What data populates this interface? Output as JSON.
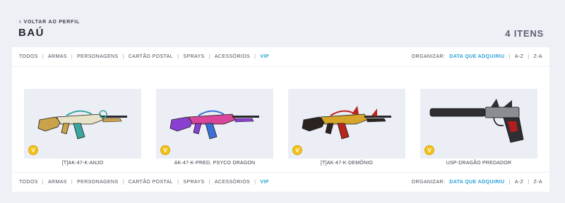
{
  "header": {
    "back_label": "VOLTAR AO PERFIL",
    "title": "BAÚ",
    "count": "4 ITENS"
  },
  "filters": {
    "categories": [
      "TODOS",
      "ARMAS",
      "PERSONAGENS",
      "CARTÃO POSTAL",
      "SPRAYS",
      "ACESSÓRIOS",
      "VIP"
    ],
    "active_category": "VIP",
    "sort_label": "ORGANIZAR:",
    "sort_options": [
      "DATA QUE ADQUIRIU",
      "A-Z",
      "Z-A"
    ],
    "active_sort": "DATA QUE ADQUIRIU"
  },
  "items": [
    {
      "name": "[T]AK-47-K-ANJO",
      "badge": "V",
      "palette": [
        "#c9a24a",
        "#e8e2c8",
        "#3aa6a0"
      ]
    },
    {
      "name": "AK-47-K-PRED. PSYCO DRAGON",
      "badge": "V",
      "palette": [
        "#8a3fd1",
        "#d8459a",
        "#3a6fd8"
      ]
    },
    {
      "name": "[T]AK-47-K-DEMÔNIO",
      "badge": "V",
      "palette": [
        "#2a2320",
        "#d6a62a",
        "#b8261e"
      ]
    },
    {
      "name": "USP-DRAGÃO PREDADOR",
      "badge": "V",
      "palette": [
        "#2e2e33",
        "#8b8d93",
        "#b01e1e"
      ]
    }
  ],
  "colors": {
    "accent": "#2a9fd8",
    "background": "#eef0f6",
    "badge": "#f2c21a"
  }
}
